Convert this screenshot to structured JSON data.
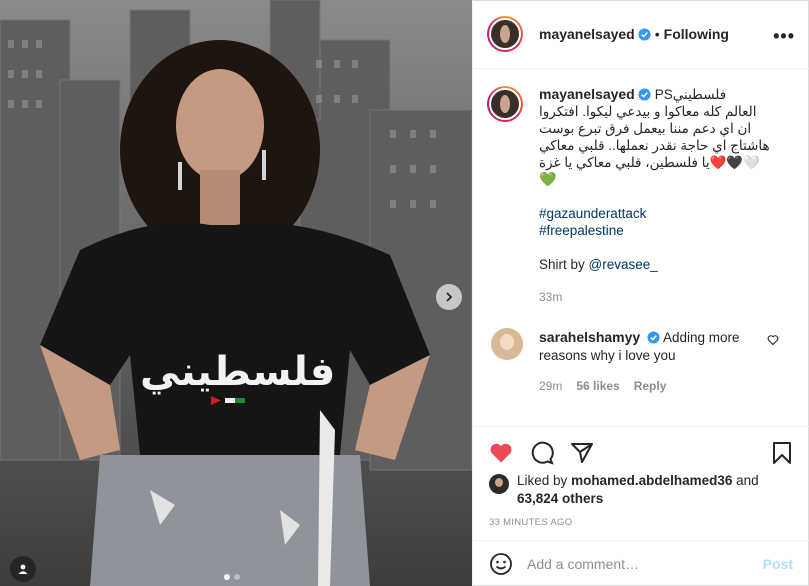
{
  "post": {
    "author": "mayanelsayed",
    "following_label": "Following",
    "header_separator": "•",
    "more_label": "•••",
    "caption": {
      "username": "mayanelsayed",
      "prefix": "PSفلسطيني",
      "arabic_lines": [
        "العالم كله معاكوا و بيدعي ليكوا. افتكروا",
        "ان اي دعم مننا بيعمل فرق تبرع بوست",
        "هاشتاج اي حاجة نقدر نعملها.. قلبي معاكي",
        "🤍🖤❤️يا فلسطين، قلبي معاكي يا غزة"
      ],
      "green_heart": "💚",
      "hashtags": [
        "#gazaunderattack",
        "#freepalestine"
      ],
      "shirt_label": "Shirt by",
      "shirt_mention": "@revasee_",
      "time": "33m"
    },
    "comment": {
      "username": "sarahelshamyy",
      "text": "Adding more reasons why i love you",
      "time": "29m",
      "likes": "56 likes",
      "reply_label": "Reply"
    },
    "likes": {
      "prefix": "Liked by",
      "by_user": "mohamed.abdelhamed36",
      "joiner": "and",
      "others": "63,824 others"
    },
    "timestamp": "33 MINUTES AGO",
    "add_comment": {
      "placeholder": "Add a comment…",
      "post_label": "Post"
    },
    "carousel": {
      "dot_count": 2,
      "active_index": 0
    },
    "colors": {
      "like_red": "#ed4956",
      "link_blue": "#00376b",
      "verified_blue": "#3897f0",
      "post_disabled": "#b2dffc"
    }
  }
}
